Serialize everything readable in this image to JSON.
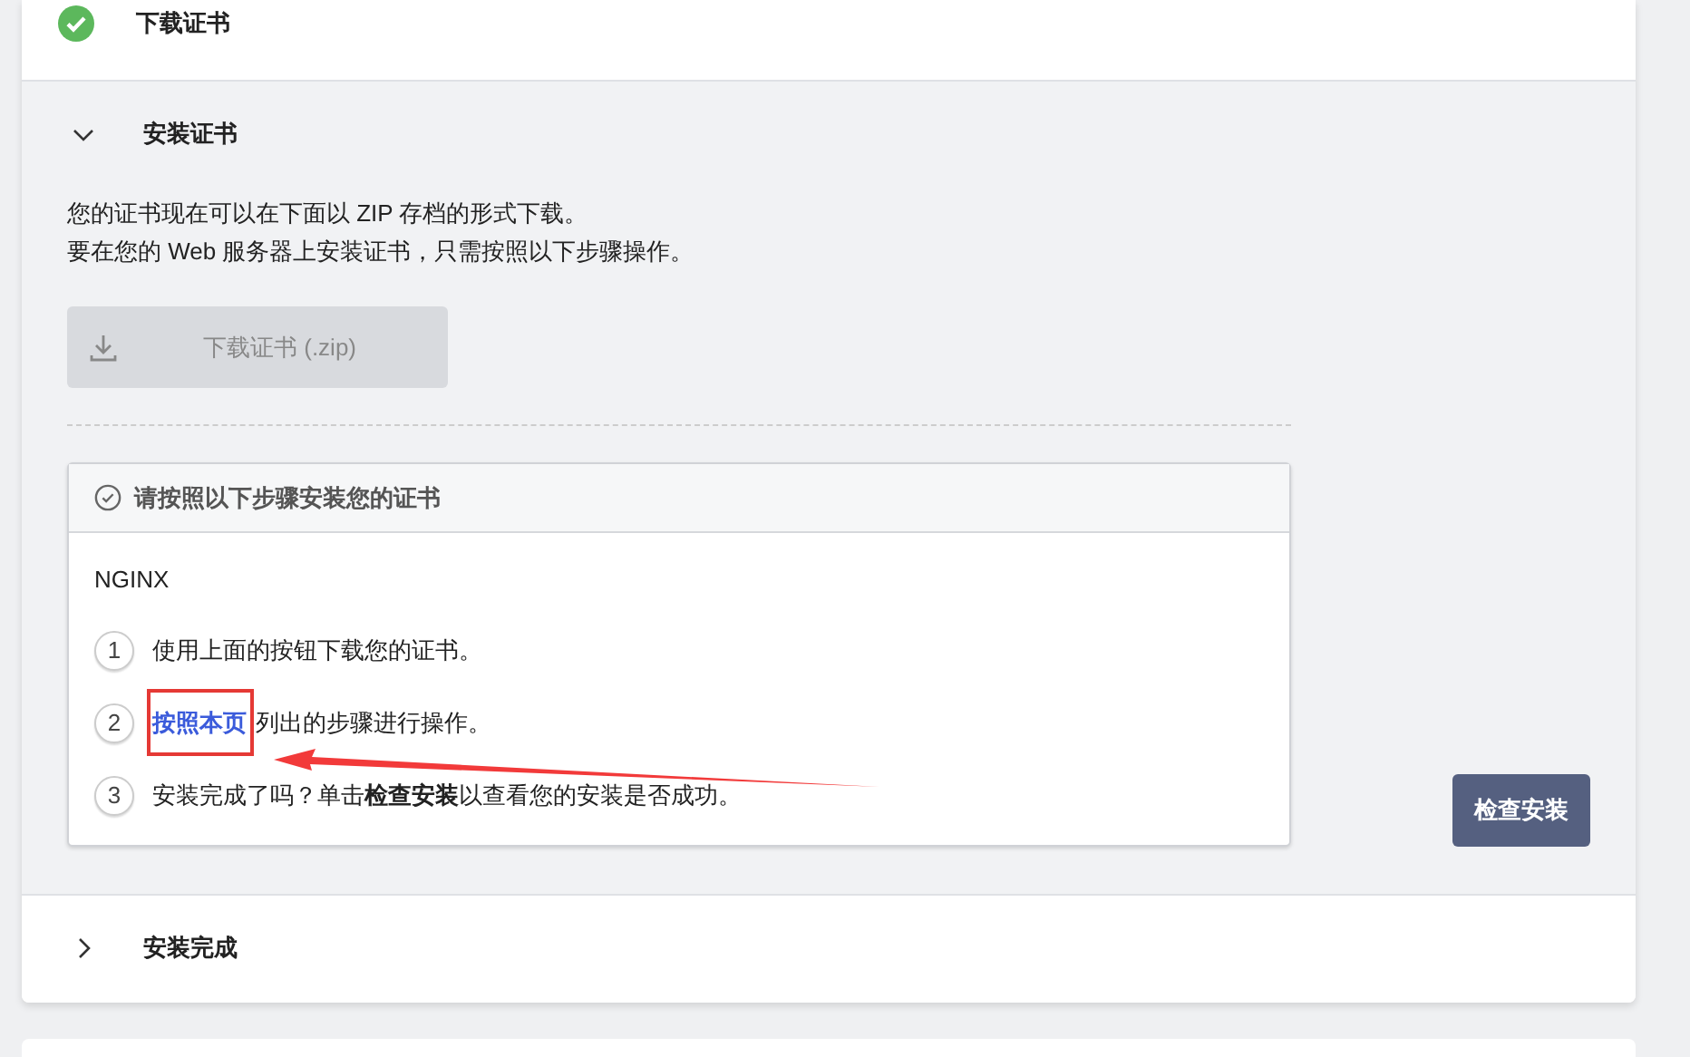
{
  "sections": [
    {
      "title": "下载证书",
      "completed": true,
      "expanded": false
    },
    {
      "title": "安装证书",
      "completed": false,
      "expanded": true
    },
    {
      "title": "安装完成",
      "completed": false,
      "expanded": false
    }
  ],
  "install": {
    "intro": [
      "您的证书现在可以在下面以 ZIP 存档的形式下载。",
      "要在您的 Web 服务器上安装证书，只需按照以下步骤操作。"
    ],
    "download_button": {
      "label": "下载证书 (.zip)",
      "disabled": true
    },
    "panel_title": "请按照以下步骤安装您的证书",
    "server": "NGINX",
    "steps": [
      {
        "number": "1",
        "text": "使用上面的按钮下载您的证书。"
      },
      {
        "number": "2",
        "link": "按照本页",
        "text": "列出的步骤进行操作。"
      },
      {
        "number": "3",
        "text": "安装完成了吗？单击**检查安装**以查看您的安装是否成功。"
      }
    ],
    "check_button": "检查安装"
  }
}
